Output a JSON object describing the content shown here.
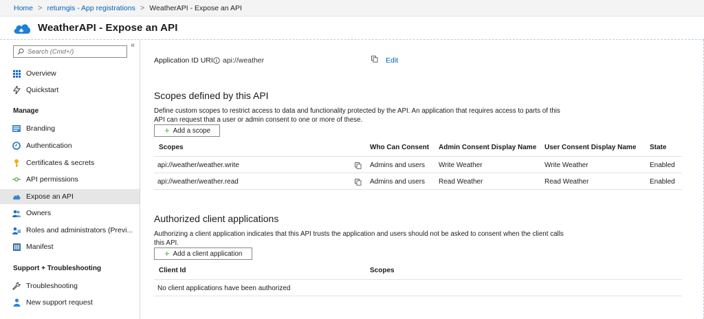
{
  "breadcrumb": {
    "items": [
      "Home",
      "returngis - App registrations",
      "WeatherAPI - Expose an API"
    ]
  },
  "page": {
    "title": "WeatherAPI - Expose an API"
  },
  "sidebar": {
    "search_placeholder": "Search (Cmd+/)",
    "collapse_glyph": "«",
    "top_items": [
      {
        "label": "Overview",
        "icon": "overview-grid-icon"
      },
      {
        "label": "Quickstart",
        "icon": "quickstart-bolt-icon"
      }
    ],
    "manage_header": "Manage",
    "manage_items": [
      {
        "label": "Branding",
        "icon": "branding-icon"
      },
      {
        "label": "Authentication",
        "icon": "authentication-icon"
      },
      {
        "label": "Certificates & secrets",
        "icon": "key-icon"
      },
      {
        "label": "API permissions",
        "icon": "api-permissions-icon"
      },
      {
        "label": "Expose an API",
        "icon": "cloud-icon",
        "active": true
      },
      {
        "label": "Owners",
        "icon": "owners-icon"
      },
      {
        "label": "Roles and administrators (Previ...",
        "icon": "roles-icon"
      },
      {
        "label": "Manifest",
        "icon": "manifest-icon"
      }
    ],
    "support_header": "Support + Troubleshooting",
    "support_items": [
      {
        "label": "Troubleshooting",
        "icon": "wrench-icon"
      },
      {
        "label": "New support request",
        "icon": "support-person-icon"
      }
    ]
  },
  "app_id": {
    "label": "Application ID URI",
    "value": "api://weather",
    "edit_label": "Edit"
  },
  "scopes": {
    "heading": "Scopes defined by this API",
    "description_line1": "Define custom scopes to restrict access to data and functionality protected by the API. An application that requires access to parts of this",
    "description_line2": "API can request that a user or admin consent to one or more of these.",
    "add_button": "Add a scope",
    "columns": [
      "Scopes",
      "Who Can Consent",
      "Admin Consent Display Name",
      "User Consent Display Name",
      "State"
    ],
    "rows": [
      {
        "scope": "api://weather/weather.write",
        "who": "Admins and users",
        "admin": "Write Weather",
        "user": "Write Weather",
        "state": "Enabled"
      },
      {
        "scope": "api://weather/weather.read",
        "who": "Admins and users",
        "admin": "Read Weather",
        "user": "Read Weather",
        "state": "Enabled"
      }
    ]
  },
  "clients": {
    "heading": "Authorized client applications",
    "description_line1": "Authorizing a client application indicates that this API trusts the application and users should not be asked to consent when the client calls",
    "description_line2": "this API.",
    "add_button": "Add a client application",
    "columns": [
      "Client Id",
      "Scopes"
    ],
    "empty_text": "No client applications have been authorized"
  },
  "colors": {
    "link": "#0063b1",
    "accent_cloud": "#1e7fd6",
    "plus_green": "#5aa34a"
  }
}
